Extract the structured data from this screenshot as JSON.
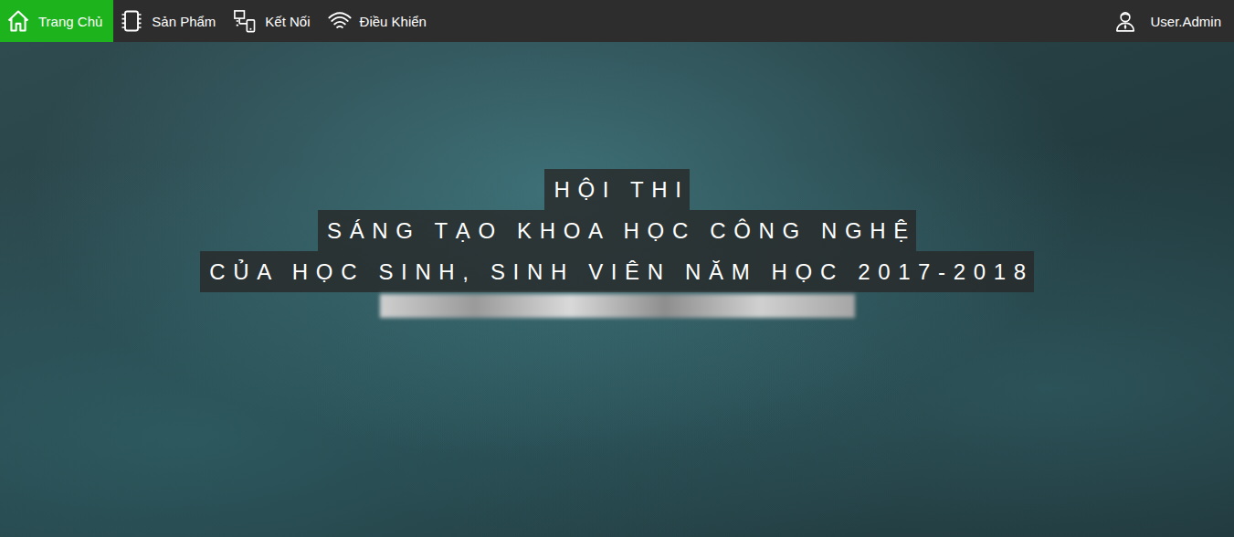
{
  "nav": {
    "items": [
      {
        "label": "Trang Chủ",
        "selected": true
      },
      {
        "label": "Sản Phẩm",
        "selected": false
      },
      {
        "label": "Kết Nối",
        "selected": false
      },
      {
        "label": "Điều Khiển",
        "selected": false
      }
    ],
    "user": {
      "label": "User.Admin"
    }
  },
  "hero": {
    "title_lines": [
      "HỘI THI",
      "SÁNG TẠO KHOA HỌC CÔNG NGHỆ",
      "CỦA HỌC SINH, SINH VIÊN NĂM HỌC 2017-2018"
    ]
  }
}
